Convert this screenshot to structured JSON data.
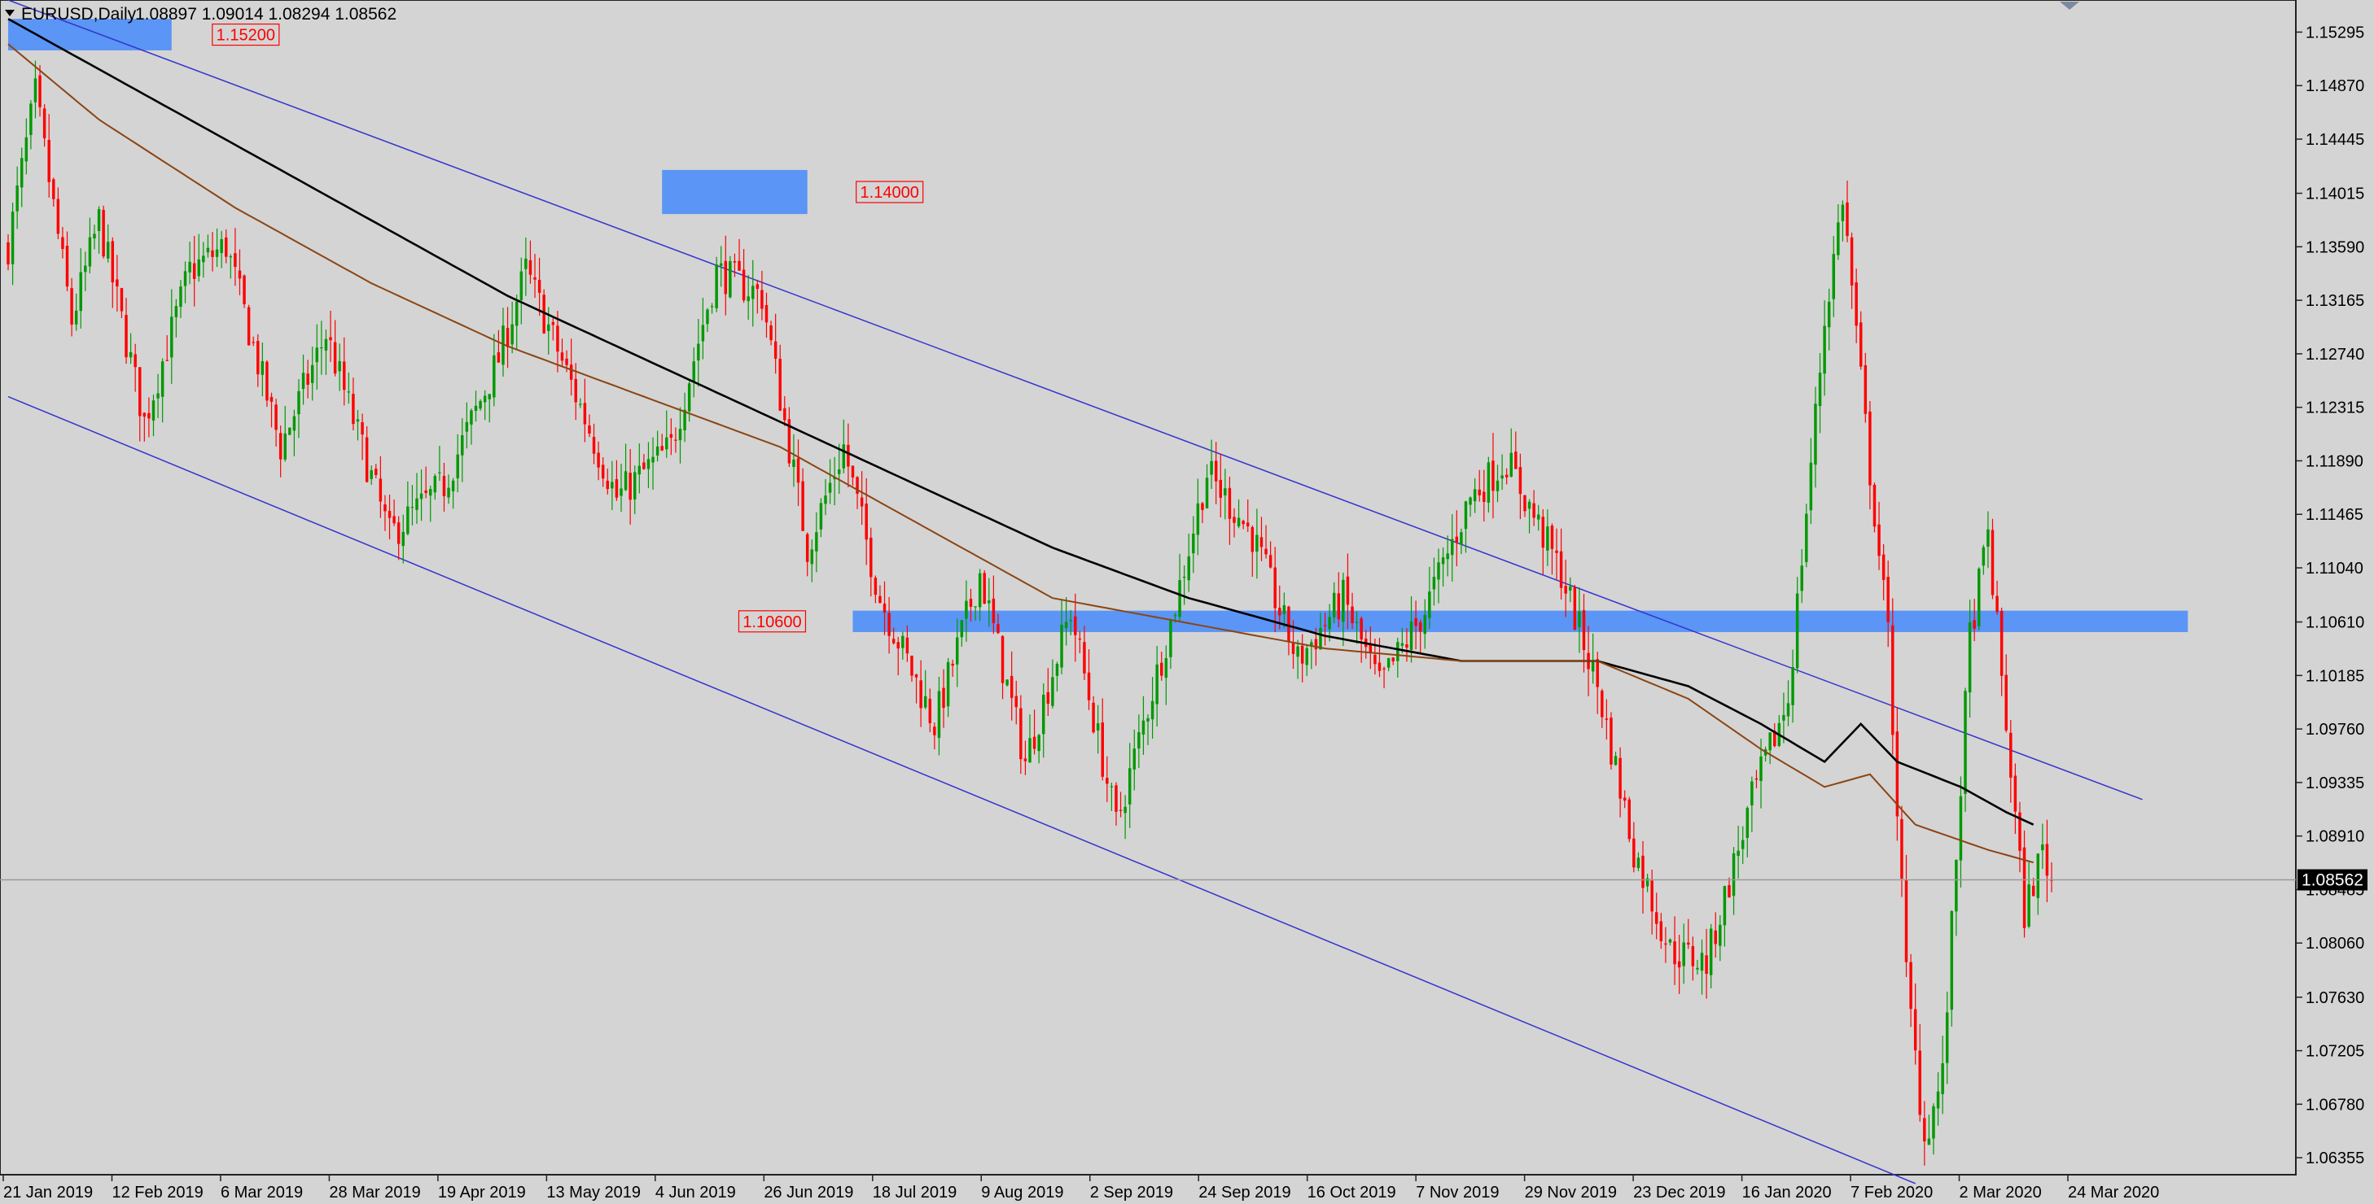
{
  "window": {
    "header_symbol": "EURUSD,Daily",
    "header_ohlc": "1.08897 1.09014 1.08294 1.08562"
  },
  "colors": {
    "background": "#d4d4d4",
    "bull": "#009900",
    "bear": "#ff0000",
    "ma_slow": "#000000",
    "ma_fast": "#8b4513",
    "channel": "#3333cc",
    "zone": "#5b95f5",
    "label": "#ff0000"
  },
  "chart_data": {
    "type": "candlestick",
    "symbol": "EURUSD",
    "timeframe": "Daily",
    "grid": false,
    "current_price": 1.08562,
    "current_price_label": "1.08562",
    "ylim": [
      1.0622,
      1.1555
    ],
    "ytick_labels": [
      "1.15295",
      "1.14870",
      "1.14445",
      "1.14015",
      "1.13590",
      "1.13165",
      "1.12740",
      "1.12315",
      "1.11890",
      "1.11465",
      "1.11040",
      "1.10610",
      "1.10185",
      "1.09760",
      "1.09335",
      "1.08910",
      "1.08485",
      "1.08060",
      "1.07630",
      "1.07205",
      "1.06780",
      "1.06355"
    ],
    "xtick_labels": [
      "21 Jan 2019",
      "12 Feb 2019",
      "6 Mar 2019",
      "28 Mar 2019",
      "19 Apr 2019",
      "13 May 2019",
      "4 Jun 2019",
      "26 Jun 2019",
      "18 Jul 2019",
      "9 Aug 2019",
      "2 Sep 2019",
      "24 Sep 2019",
      "16 Oct 2019",
      "7 Nov 2019",
      "29 Nov 2019",
      "23 Dec 2019",
      "16 Jan 2020",
      "7 Feb 2020",
      "2 Mar 2020",
      "24 Mar 2020"
    ],
    "price_path": [
      [
        0,
        1.136
      ],
      [
        6,
        1.148
      ],
      [
        14,
        1.13
      ],
      [
        20,
        1.138
      ],
      [
        30,
        1.122
      ],
      [
        40,
        1.134
      ],
      [
        48,
        1.136
      ],
      [
        60,
        1.12
      ],
      [
        70,
        1.129
      ],
      [
        84,
        1.113
      ],
      [
        96,
        1.117
      ],
      [
        108,
        1.127
      ],
      [
        114,
        1.134
      ],
      [
        124,
        1.125
      ],
      [
        134,
        1.116
      ],
      [
        146,
        1.12
      ],
      [
        156,
        1.134
      ],
      [
        166,
        1.132
      ],
      [
        176,
        1.112
      ],
      [
        184,
        1.12
      ],
      [
        192,
        1.108
      ],
      [
        204,
        1.098
      ],
      [
        214,
        1.11
      ],
      [
        224,
        1.095
      ],
      [
        234,
        1.107
      ],
      [
        244,
        1.09
      ],
      [
        256,
        1.106
      ],
      [
        264,
        1.118
      ],
      [
        274,
        1.113
      ],
      [
        284,
        1.103
      ],
      [
        294,
        1.108
      ],
      [
        302,
        1.101
      ],
      [
        312,
        1.107
      ],
      [
        322,
        1.116
      ],
      [
        330,
        1.119
      ],
      [
        342,
        1.11
      ],
      [
        350,
        1.101
      ],
      [
        358,
        1.088
      ],
      [
        366,
        1.08
      ],
      [
        374,
        1.079
      ],
      [
        384,
        1.092
      ],
      [
        392,
        1.1
      ],
      [
        400,
        1.13
      ],
      [
        404,
        1.14
      ],
      [
        410,
        1.118
      ],
      [
        414,
        1.105
      ],
      [
        418,
        1.078
      ],
      [
        422,
        1.065
      ],
      [
        426,
        1.07
      ],
      [
        432,
        1.105
      ],
      [
        436,
        1.113
      ],
      [
        440,
        1.098
      ],
      [
        444,
        1.083
      ],
      [
        448,
        1.088
      ],
      [
        450,
        1.0856
      ]
    ],
    "candles": {
      "n": 451,
      "x_start": 0,
      "x_end": 450,
      "bullish_color": "green",
      "bearish_color": "red"
    },
    "moving_averages": [
      {
        "color": "black",
        "values": [
          [
            0,
            1.154
          ],
          [
            20,
            1.15
          ],
          [
            50,
            1.144
          ],
          [
            80,
            1.138
          ],
          [
            110,
            1.132
          ],
          [
            140,
            1.127
          ],
          [
            170,
            1.122
          ],
          [
            200,
            1.117
          ],
          [
            230,
            1.112
          ],
          [
            260,
            1.108
          ],
          [
            290,
            1.105
          ],
          [
            320,
            1.103
          ],
          [
            350,
            1.103
          ],
          [
            370,
            1.101
          ],
          [
            386,
            1.098
          ],
          [
            400,
            1.095
          ],
          [
            408,
            1.098
          ],
          [
            416,
            1.095
          ],
          [
            430,
            1.093
          ],
          [
            440,
            1.091
          ],
          [
            446,
            1.09
          ]
        ]
      },
      {
        "color": "brown",
        "values": [
          [
            0,
            1.152
          ],
          [
            20,
            1.146
          ],
          [
            50,
            1.139
          ],
          [
            80,
            1.133
          ],
          [
            110,
            1.128
          ],
          [
            140,
            1.124
          ],
          [
            170,
            1.12
          ],
          [
            200,
            1.114
          ],
          [
            230,
            1.108
          ],
          [
            260,
            1.106
          ],
          [
            290,
            1.104
          ],
          [
            320,
            1.103
          ],
          [
            350,
            1.103
          ],
          [
            370,
            1.1
          ],
          [
            386,
            1.096
          ],
          [
            400,
            1.093
          ],
          [
            410,
            1.094
          ],
          [
            420,
            1.09
          ],
          [
            436,
            1.088
          ],
          [
            446,
            1.087
          ]
        ]
      }
    ],
    "trendlines": [
      {
        "name": "channel-upper",
        "from": [
          0,
          1.1555
        ],
        "to": [
          470,
          1.092
        ]
      },
      {
        "name": "channel-lower",
        "from": [
          0,
          1.124
        ],
        "to": [
          420,
          1.0615
        ]
      }
    ],
    "zones": [
      {
        "label": "1.15200",
        "price_top": 1.154,
        "price_bottom": 1.1515,
        "x_from": 0,
        "x_to": 36
      },
      {
        "label": "1.14000",
        "price_top": 1.142,
        "price_bottom": 1.1385,
        "x_from": 144,
        "x_to": 176
      },
      {
        "label": "1.10600",
        "price_top": 1.107,
        "price_bottom": 1.1053,
        "x_from": 186,
        "x_to": 480
      }
    ]
  }
}
